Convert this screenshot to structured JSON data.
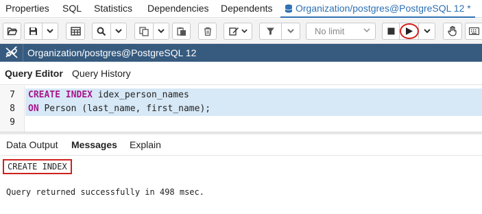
{
  "tabs": {
    "items": [
      {
        "label": "Properties"
      },
      {
        "label": "SQL"
      },
      {
        "label": "Statistics"
      },
      {
        "label": "Dependencies"
      },
      {
        "label": "Dependents"
      },
      {
        "label": "Organization/postgres@PostgreSQL 12 *",
        "icon": "database-icon",
        "active": true
      }
    ]
  },
  "toolbar": {
    "limit_select": "No limit",
    "icons": [
      "open-folder-icon",
      "save-icon",
      "chevron-down-icon",
      "table-grid-icon",
      "search-icon",
      "copy-icon",
      "paste-icon",
      "delete-icon",
      "edit-icon",
      "filter-icon",
      "stop-icon",
      "play-icon",
      "hand-icon",
      "keyboard-icon"
    ],
    "highlight_color": "#d0201d"
  },
  "connection": {
    "label": "Organization/postgres@PostgreSQL 12",
    "bar_color": "#375b7f"
  },
  "editor_tabs": [
    {
      "label": "Query Editor",
      "active": true
    },
    {
      "label": "Query History"
    }
  ],
  "editor": {
    "lines": [
      {
        "num": "7",
        "kw": "CREATE INDEX",
        "rest": " idex_person_names"
      },
      {
        "num": "8",
        "kw": "ON",
        "rest": " Person (last_name, first_name);"
      },
      {
        "num": "9",
        "kw": "",
        "rest": ""
      }
    ],
    "keyword_color": "#a8168c",
    "selection_color": "#d7e8f6"
  },
  "output_tabs": [
    {
      "label": "Data Output"
    },
    {
      "label": "Messages",
      "active": true
    },
    {
      "label": "Explain"
    }
  ],
  "messages": {
    "line1": "CREATE INDEX",
    "line2": "Query returned successfully in 498 msec."
  }
}
